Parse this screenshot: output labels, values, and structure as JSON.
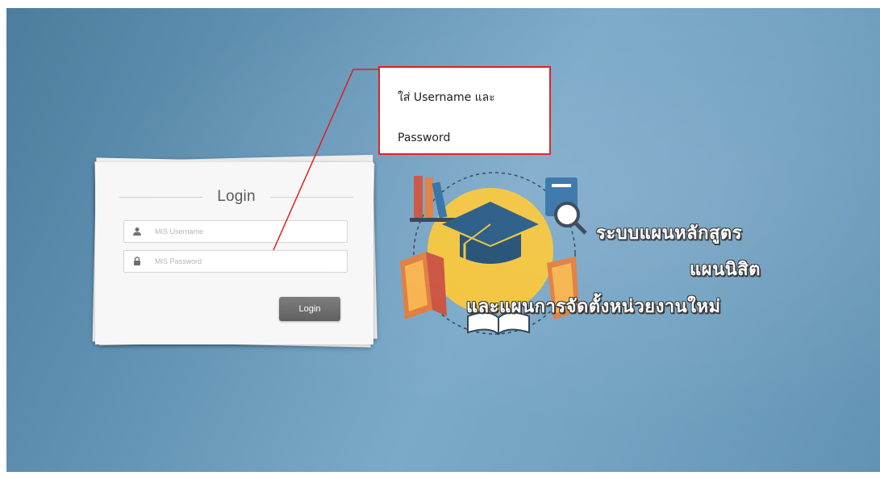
{
  "login_card": {
    "title": "Login",
    "username_placeholder": "MIS Username",
    "password_placeholder": "MIS Password",
    "login_button_label": "Login"
  },
  "callout": {
    "line1": "ใส่ Username และ",
    "line2": "Password",
    "border_color": "#e01717"
  },
  "logo": {
    "line1": "ระบบแผนหลักสูตร",
    "line2": "แผนนิสิต",
    "line3": "และแผนการจัดตั้งหน่วยงานใหม่"
  },
  "icons": [
    "user-icon",
    "lock-icon",
    "graduation-cap-icon",
    "book-icon",
    "magnifier-icon"
  ],
  "colors": {
    "background": "#6a9abb",
    "accent_yellow": "#f2c33a",
    "button": "#666666"
  }
}
